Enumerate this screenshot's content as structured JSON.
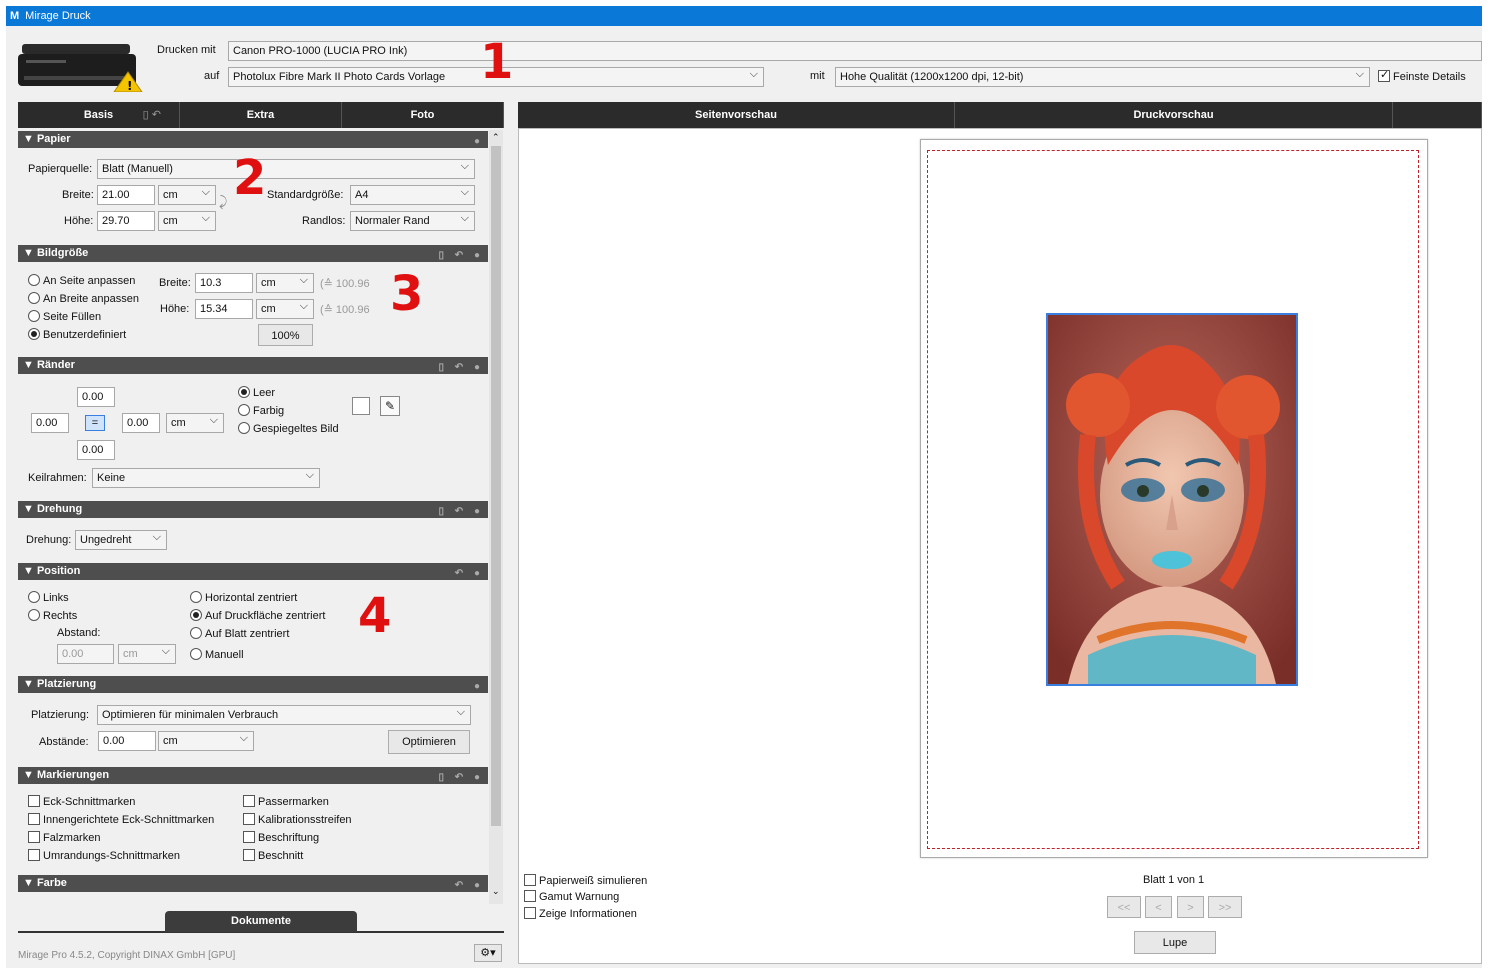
{
  "window": {
    "title": "Mirage Druck",
    "logo": "M"
  },
  "header": {
    "print_with_label": "Drucken mit",
    "printer": "Canon PRO-1000 (LUCIA PRO Ink)",
    "on_label": "auf",
    "media": "Photolux Fibre Mark II Photo Cards Vorlage",
    "with_label": "mit",
    "quality": "Hohe Qualität (1200x1200 dpi, 12-bit)",
    "fine_detail_label": "Feinste Details",
    "fine_detail_checked": true
  },
  "annotations": [
    "1",
    "2",
    "3",
    "4"
  ],
  "tabs": [
    "Basis",
    "Extra",
    "Foto"
  ],
  "preview_tabs": [
    "Seitenvorschau",
    "Druckvorschau"
  ],
  "papier": {
    "title": "Papier",
    "source_label": "Papierquelle:",
    "source": "Blatt (Manuell)",
    "width_label": "Breite:",
    "width": "21.00",
    "width_unit": "cm",
    "height_label": "Höhe:",
    "height": "29.70",
    "height_unit": "cm",
    "std_size_label": "Standardgröße:",
    "std_size": "A4",
    "borderless_label": "Randlos:",
    "borderless": "Normaler Rand"
  },
  "bildgroesse": {
    "title": "Bildgröße",
    "options": [
      "An Seite anpassen",
      "An Breite anpassen",
      "Seite Füllen",
      "Benutzerdefiniert"
    ],
    "selected": 3,
    "width_label": "Breite:",
    "width": "10.3",
    "width_unit": "cm",
    "width_hint": "(≙ 100.96",
    "height_label": "Höhe:",
    "height": "15.34",
    "height_unit": "cm",
    "height_hint": "(≙ 100.96",
    "scale": "100%"
  },
  "raender": {
    "title": "Ränder",
    "top": "0.00",
    "left": "0.00",
    "right": "0.00",
    "bottom": "0.00",
    "link": "=",
    "unit": "cm",
    "options": [
      "Leer",
      "Farbig",
      "Gespiegeltes Bild"
    ],
    "selected": 0,
    "frame_label": "Keilrahmen:",
    "frame": "Keine"
  },
  "drehung": {
    "title": "Drehung",
    "label": "Drehung:",
    "value": "Ungedreht"
  },
  "position": {
    "title": "Position",
    "left_opts": [
      "Links",
      "Rechts"
    ],
    "distance_label": "Abstand:",
    "distance": "0.00",
    "distance_unit": "cm",
    "right_opts": [
      "Horizontal zentriert",
      "Auf Druckfläche zentriert",
      "Auf Blatt zentriert",
      "Manuell"
    ],
    "selected_right": 1
  },
  "platzierung": {
    "title": "Platzierung",
    "label": "Platzierung:",
    "value": "Optimieren für minimalen Verbrauch",
    "gap_label": "Abstände:",
    "gap": "0.00",
    "gap_unit": "cm",
    "optimize_btn": "Optimieren"
  },
  "markierungen": {
    "title": "Markierungen",
    "col1": [
      "Eck-Schnittmarken",
      "Innengerichtete Eck-Schnittmarken",
      "Falzmarken",
      "Umrandungs-Schnittmarken"
    ],
    "col2": [
      "Passermarken",
      "Kalibrationsstreifen",
      "Beschriftung",
      "Beschnitt"
    ]
  },
  "farbe": {
    "title": "Farbe"
  },
  "dokumente_tab": "Dokumente",
  "footer": "Mirage Pro 4.5.2, Copyright DINAX GmbH [GPU]",
  "preview_options": [
    "Papierweiß simulieren",
    "Gamut Warnung",
    "Zeige Informationen"
  ],
  "page_info": "Blatt 1 von 1",
  "nav": [
    "<<",
    "<",
    ">",
    ">>"
  ],
  "lupe": "Lupe",
  "colors": {
    "accent": "#0a78d7",
    "annotation": "#e01010",
    "image_border": "#3a7ee0"
  }
}
